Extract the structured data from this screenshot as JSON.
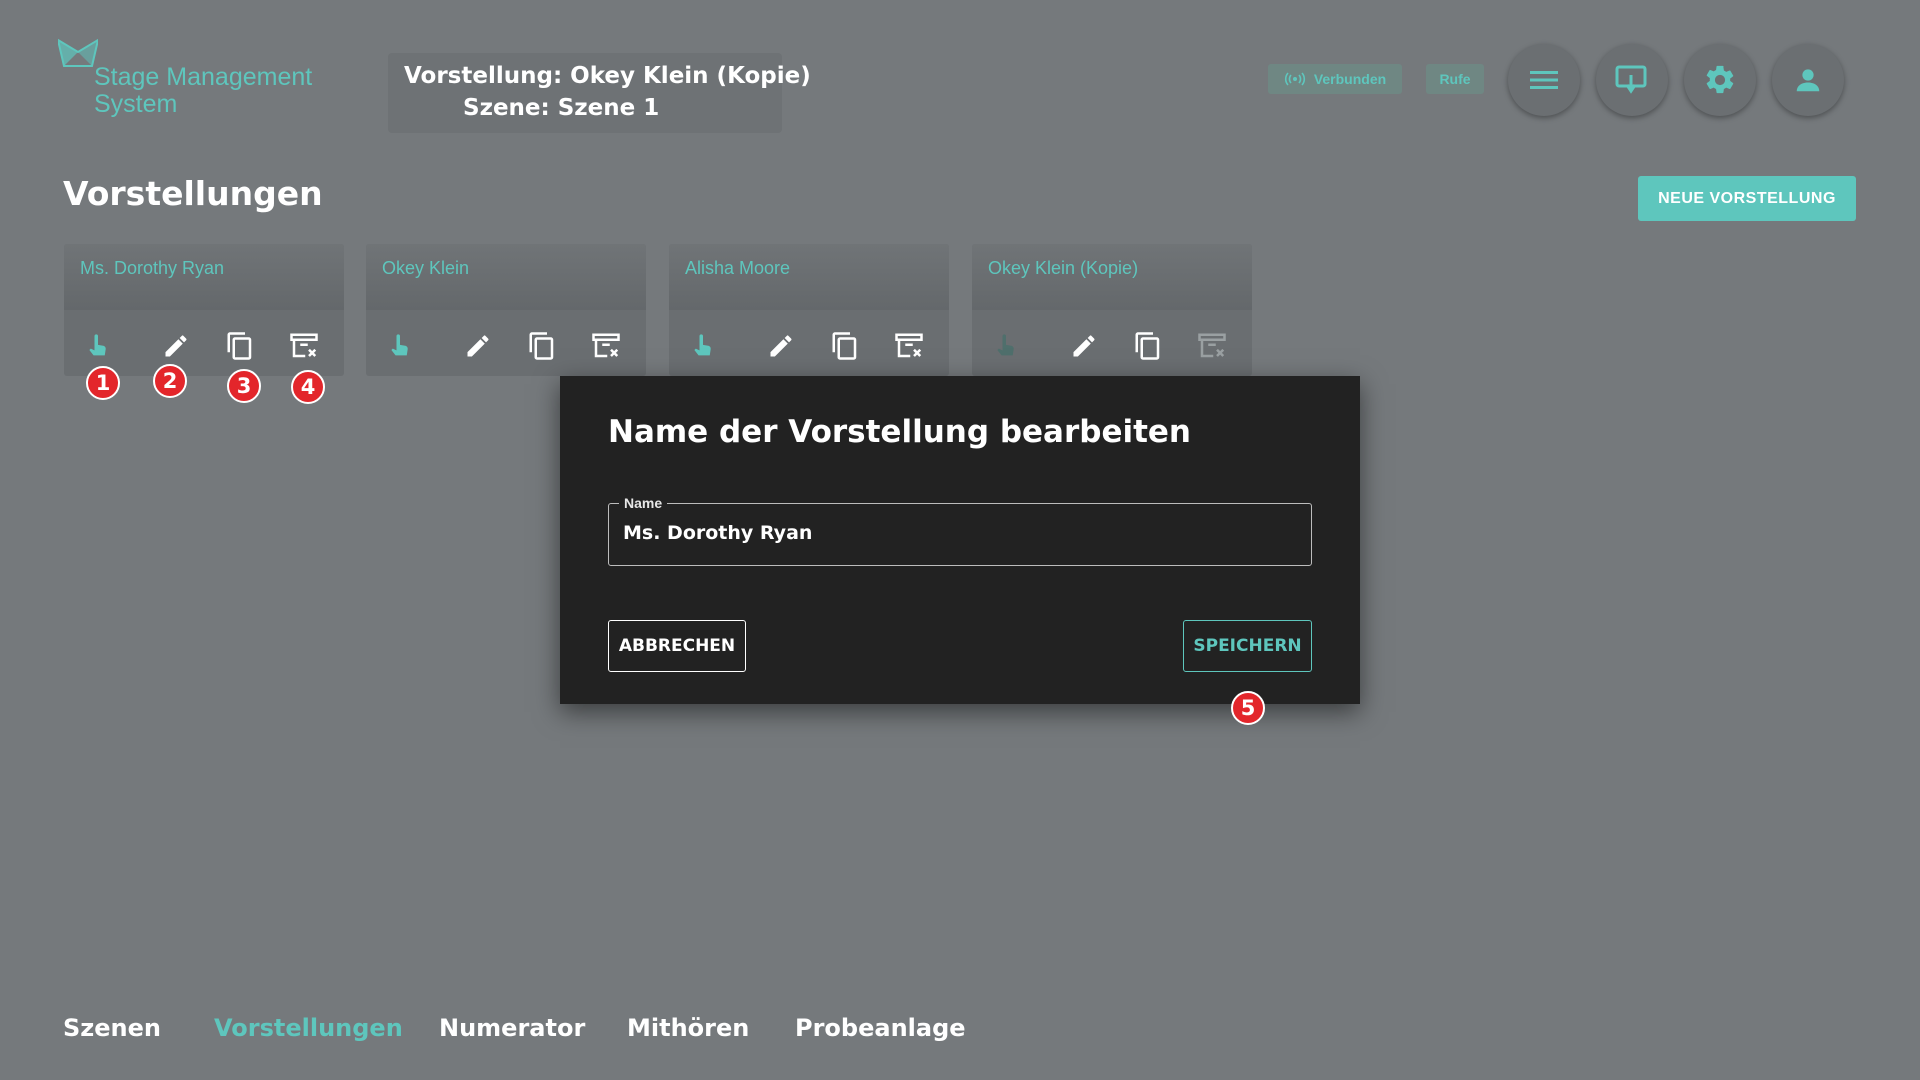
{
  "header": {
    "logo_text_line1": "Stage Management",
    "logo_text_line2": "System",
    "current_show_label": "Vorstellung:",
    "current_show_value": "Okey Klein (Kopie)",
    "current_scene_label": "Szene:",
    "current_scene_value": "Szene 1",
    "status_connected": "Verbunden",
    "calls_label": "Rufe",
    "buttons": {
      "menu_icon": "menu-icon",
      "screen_icon": "screen-touch-icon",
      "settings_icon": "gear-icon",
      "account_icon": "person-icon"
    }
  },
  "page": {
    "title": "Vorstellungen",
    "new_button_label": "NEUE VORSTELLUNG"
  },
  "cards": [
    {
      "name": "Ms. Dorothy Ryan",
      "select_active": true
    },
    {
      "name": "Okey Klein",
      "select_active": true
    },
    {
      "name": "Alisha Moore",
      "select_active": true
    },
    {
      "name": "Okey Klein (Kopie)",
      "select_active": false
    }
  ],
  "badges": [
    "1",
    "2",
    "3",
    "4",
    "5"
  ],
  "dialog": {
    "title": "Name der Vorstellung bearbeiten",
    "field_label": "Name",
    "field_value": "Ms. Dorothy Ryan",
    "cancel_label": "ABBRECHEN",
    "save_label": "SPEICHERN"
  },
  "bottom_nav": [
    {
      "label": "Szenen",
      "active": false
    },
    {
      "label": "Vorstellungen",
      "active": true
    },
    {
      "label": "Numerator",
      "active": false
    },
    {
      "label": "Mithören",
      "active": false
    },
    {
      "label": "Probeanlage",
      "active": false
    }
  ],
  "colors": {
    "accent": "#5ec6bd",
    "background": "#75797c",
    "dialog": "#222222",
    "badge": "#e3262b"
  }
}
